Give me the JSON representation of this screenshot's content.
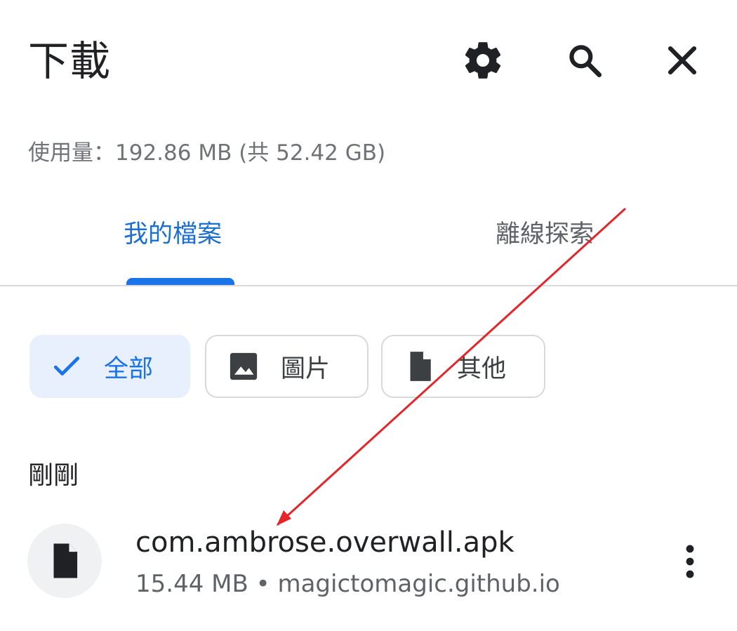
{
  "header": {
    "title": "下載"
  },
  "storage": {
    "text": "使用量：192.86 MB (共 52.42 GB)"
  },
  "tabs": [
    {
      "label": "我的檔案",
      "selected": true
    },
    {
      "label": "離線探索",
      "selected": false
    }
  ],
  "filters": [
    {
      "label": "全部",
      "icon": "checkmark-icon",
      "selected": true
    },
    {
      "label": "圖片",
      "icon": "image-icon",
      "selected": false
    },
    {
      "label": "其他",
      "icon": "document-icon",
      "selected": false
    }
  ],
  "section": {
    "label": "剛剛"
  },
  "downloads": [
    {
      "name": "com.ambrose.overwall.apk",
      "details": "15.44 MB • magictomagic.github.io",
      "icon": "document-icon"
    }
  ],
  "icons": {
    "settings": "gear-icon",
    "search": "search-icon",
    "close": "close-icon",
    "more": "more-vertical-icon"
  },
  "colors": {
    "accent": "#1a73e8",
    "chip_selected_background": "#e8f0fe",
    "primary_text": "#202124",
    "secondary_text": "#5f6368",
    "annotation": "#e4262b"
  }
}
